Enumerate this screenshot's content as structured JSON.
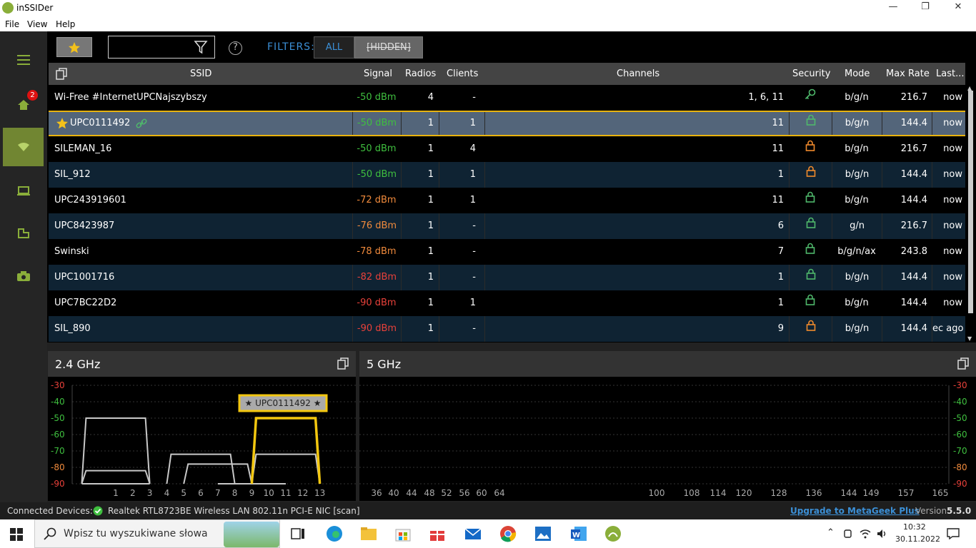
{
  "app": {
    "title": "inSSIDer"
  },
  "menu": [
    "File",
    "View",
    "Help"
  ],
  "sidebar": {
    "badge": "2"
  },
  "toolbar": {
    "search_placeholder": "",
    "filters_label": "FILTERS:",
    "all_label": "ALL",
    "hidden_label": "[HIDDEN]"
  },
  "columns": {
    "ssid": "SSID",
    "signal": "Signal",
    "radios": "Radios",
    "clients": "Clients",
    "channels": "Channels",
    "security": "Security",
    "mode": "Mode",
    "maxrate": "Max Rate",
    "last": "Last..."
  },
  "networks": [
    {
      "ssid": "Wi-Free #InternetUPCNajszybszy",
      "signal": "-50 dBm",
      "radios": "4",
      "clients": "-",
      "channels": "1, 6, 11",
      "security": "key",
      "mode": "b/g/n",
      "maxrate": "216.7",
      "last": "now"
    },
    {
      "ssid": "UPC0111492",
      "signal": "-50 dBm",
      "radios": "1",
      "clients": "1",
      "channels": "11",
      "security": "lock-green",
      "mode": "b/g/n",
      "maxrate": "144.4",
      "last": "now"
    },
    {
      "ssid": "SILEMAN_16",
      "signal": "-50 dBm",
      "radios": "1",
      "clients": "4",
      "channels": "11",
      "security": "lock-orange",
      "mode": "b/g/n",
      "maxrate": "216.7",
      "last": "now"
    },
    {
      "ssid": "SIL_912",
      "signal": "-50 dBm",
      "radios": "1",
      "clients": "1",
      "channels": "1",
      "security": "lock-orange",
      "mode": "b/g/n",
      "maxrate": "144.4",
      "last": "now"
    },
    {
      "ssid": "UPC243919601",
      "signal": "-72 dBm",
      "radios": "1",
      "clients": "1",
      "channels": "11",
      "security": "lock-green",
      "mode": "b/g/n",
      "maxrate": "144.4",
      "last": "now"
    },
    {
      "ssid": "UPC8423987",
      "signal": "-76 dBm",
      "radios": "1",
      "clients": "-",
      "channels": "6",
      "security": "lock-green",
      "mode": "g/n",
      "maxrate": "216.7",
      "last": "now"
    },
    {
      "ssid": "Swinski",
      "signal": "-78 dBm",
      "radios": "1",
      "clients": "-",
      "channels": "7",
      "security": "lock-green",
      "mode": "b/g/n/ax",
      "maxrate": "243.8",
      "last": "now"
    },
    {
      "ssid": "UPC1001716",
      "signal": "-82 dBm",
      "radios": "1",
      "clients": "-",
      "channels": "1",
      "security": "lock-green",
      "mode": "b/g/n",
      "maxrate": "144.4",
      "last": "now"
    },
    {
      "ssid": "UPC7BC22D2",
      "signal": "-90 dBm",
      "radios": "1",
      "clients": "1",
      "channels": "1",
      "security": "lock-green",
      "mode": "b/g/n",
      "maxrate": "144.4",
      "last": "now"
    },
    {
      "ssid": "SIL_890",
      "signal": "-90 dBm",
      "radios": "1",
      "clients": "-",
      "channels": "9",
      "security": "lock-orange",
      "mode": "b/g/n",
      "maxrate": "144.4",
      "last": "ec ago"
    }
  ],
  "colors": {
    "signal_good": "#3fbf3f",
    "signal_mid": "#f08a3c",
    "signal_bad": "#e8413a",
    "selected_border": "#e8b30f",
    "accent_green": "#8aae3a"
  },
  "panels": {
    "ghz24": {
      "title": "2.4 GHz",
      "tooltip": "★ UPC0111492 ★",
      "yticks": [
        "-30",
        "-40",
        "-50",
        "-60",
        "-70",
        "-80",
        "-90"
      ],
      "xticks": [
        "1",
        "2",
        "3",
        "4",
        "5",
        "6",
        "7",
        "8",
        "9",
        "10",
        "11",
        "12",
        "13"
      ]
    },
    "ghz5": {
      "title": "5 GHz",
      "yticks": [
        "-30",
        "-40",
        "-50",
        "-60",
        "-70",
        "-80",
        "-90"
      ],
      "xticks": [
        "36",
        "40",
        "44",
        "48",
        "52",
        "56",
        "60",
        "64",
        "100",
        "108",
        "114",
        "120",
        "128",
        "136",
        "144",
        "149",
        "157",
        "165"
      ]
    }
  },
  "chart_data": {
    "type": "area",
    "title": "2.4 GHz",
    "x_axis": "channel",
    "y_axis": "dBm",
    "ylim": [
      -90,
      -30
    ],
    "series": [
      {
        "center": 1,
        "width": 4,
        "signal": -50,
        "selected": false
      },
      {
        "center": 1,
        "width": 4,
        "signal": -82,
        "selected": false
      },
      {
        "center": 1,
        "width": 4,
        "signal": -90,
        "selected": false
      },
      {
        "center": 6,
        "width": 4,
        "signal": -72,
        "selected": false
      },
      {
        "center": 7,
        "width": 4,
        "signal": -78,
        "selected": false
      },
      {
        "center": 9,
        "width": 4,
        "signal": -90,
        "selected": false
      },
      {
        "center": 11,
        "width": 4,
        "signal": -72,
        "selected": false
      },
      {
        "center": 11,
        "width": 4,
        "signal": -50,
        "selected": true
      }
    ]
  },
  "status": {
    "label": "Connected Devices:",
    "device": "Realtek RTL8723BE Wireless LAN 802.11n PCI-E NIC [scan]",
    "upgrade": "Upgrade to MetaGeek Plus",
    "version_label": "Version",
    "version": "5.5.0"
  },
  "taskbar": {
    "search_placeholder": "Wpisz tu wyszukiwane słowa",
    "time": "10:32",
    "date": "30.11.2022"
  }
}
